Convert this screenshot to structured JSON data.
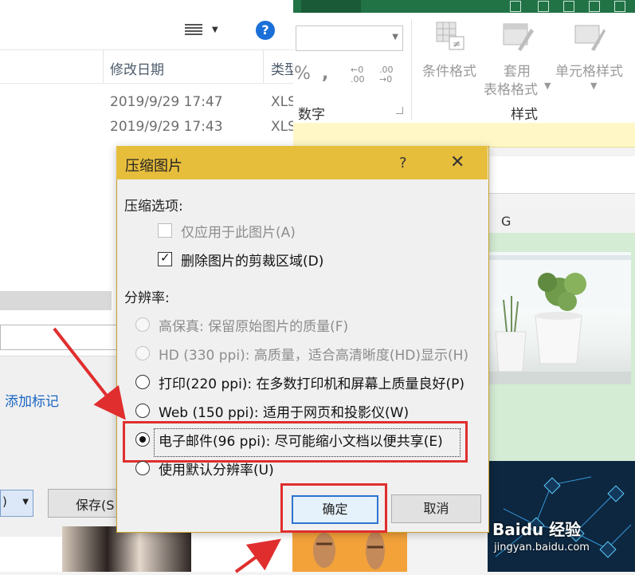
{
  "explorer": {
    "columns": {
      "modified": "修改日期",
      "type": "类型"
    },
    "rows": [
      {
        "date": "2019/9/29 17:47",
        "type": "XLS"
      },
      {
        "date": "2019/9/29 17:43",
        "type": "XLS"
      }
    ],
    "add_tag": "添加标记",
    "select_value": ")",
    "save_label": "保存(S"
  },
  "excel": {
    "number_group": "数字",
    "percent": "%",
    "comma": ",",
    "dec_increase": [
      "←0",
      ".00"
    ],
    "dec_decrease": [
      ".00",
      "→0"
    ],
    "style_group": "样式",
    "cond_format": "条件格式",
    "table_format_1": "套用",
    "table_format_2": "表格格式",
    "cell_style": "单元格样式",
    "column_g": "G",
    "watermark": "Baidu 经验",
    "watermark_sub": "jingyan.baidu.com"
  },
  "dialog": {
    "title": "压缩图片",
    "help": "?",
    "close": "✕",
    "compress_options_label": "压缩选项:",
    "apply_only_this": "仅应用于此图片(A)",
    "delete_cropped": "删除图片的剪裁区域(D)",
    "resolution_label": "分辨率:",
    "options": [
      {
        "label": "高保真: 保留原始图片的质量(F)",
        "enabled": false,
        "selected": false
      },
      {
        "label": "HD (330 ppi): 高质量，适合高清晰度(HD)显示(H)",
        "enabled": false,
        "selected": false
      },
      {
        "label": "打印(220 ppi): 在多数打印机和屏幕上质量良好(P)",
        "enabled": true,
        "selected": false
      },
      {
        "label": "Web (150 ppi): 适用于网页和投影仪(W)",
        "enabled": true,
        "selected": false
      },
      {
        "label": "电子邮件(96 ppi): 尽可能缩小文档以便共享(E)",
        "enabled": true,
        "selected": true
      },
      {
        "label": "使用默认分辨率(U)",
        "enabled": true,
        "selected": false
      }
    ],
    "ok": "确定",
    "cancel": "取消"
  },
  "colors": {
    "dialog_title_bg": "#e7bd3c",
    "highlight": "#e02e2e",
    "excel_green": "#217346",
    "link_blue": "#1a66c4"
  }
}
